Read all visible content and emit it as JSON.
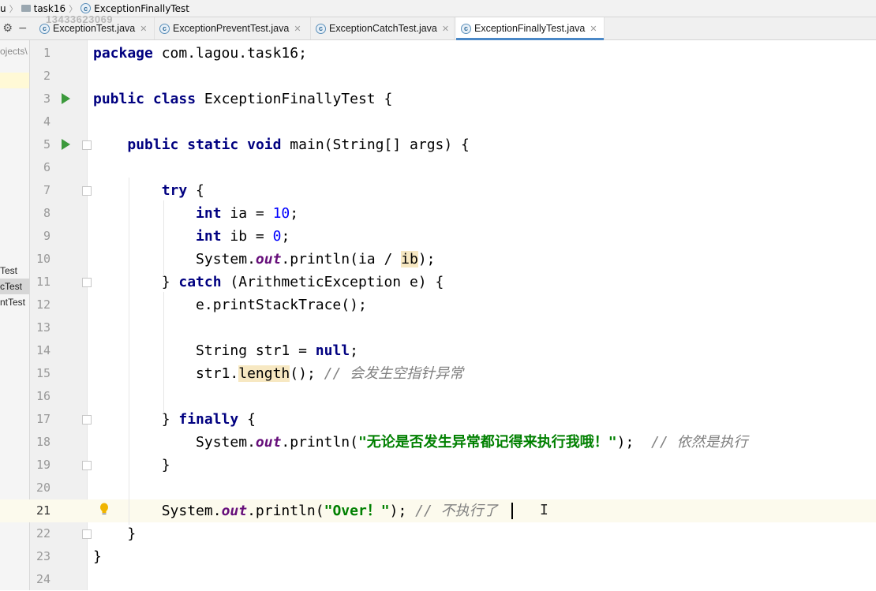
{
  "breadcrumb": {
    "root": "u",
    "folder": "task16",
    "file": "ExceptionFinallyTest"
  },
  "watermark": "13433623069",
  "tab_tools": {
    "settings": "⚙",
    "minimize": "−"
  },
  "tabs": [
    {
      "label": "ExceptionTest.java",
      "active": false
    },
    {
      "label": "ExceptionPreventTest.java",
      "active": false
    },
    {
      "label": "ExceptionCatchTest.java",
      "active": false
    },
    {
      "label": "ExceptionFinallyTest.java",
      "active": true
    }
  ],
  "project_panel": {
    "items": [
      "ojects\\",
      "Test",
      "cTest",
      "ntTest"
    ]
  },
  "editor": {
    "current_line": 21,
    "lines": [
      {
        "n": "1",
        "tokens": [
          [
            "kw",
            "package"
          ],
          [
            "p",
            " com.lagou.task16;"
          ]
        ]
      },
      {
        "n": "2",
        "tokens": []
      },
      {
        "n": "3",
        "tokens": [
          [
            "kw",
            "public"
          ],
          [
            "p",
            " "
          ],
          [
            "kw",
            "class"
          ],
          [
            "p",
            " ExceptionFinallyTest {"
          ]
        ]
      },
      {
        "n": "4",
        "tokens": []
      },
      {
        "n": "5",
        "tokens": [
          [
            "p",
            "    "
          ],
          [
            "kw",
            "public"
          ],
          [
            "p",
            " "
          ],
          [
            "kw",
            "static"
          ],
          [
            "p",
            " "
          ],
          [
            "kw",
            "void"
          ],
          [
            "p",
            " main(String[] args) {"
          ]
        ]
      },
      {
        "n": "6",
        "tokens": []
      },
      {
        "n": "7",
        "tokens": [
          [
            "p",
            "        "
          ],
          [
            "kw",
            "try"
          ],
          [
            "p",
            " {"
          ]
        ]
      },
      {
        "n": "8",
        "tokens": [
          [
            "p",
            "            "
          ],
          [
            "kw",
            "int"
          ],
          [
            "p",
            " ia = "
          ],
          [
            "num",
            "10"
          ],
          [
            "p",
            ";"
          ]
        ]
      },
      {
        "n": "9",
        "tokens": [
          [
            "p",
            "            "
          ],
          [
            "kw",
            "int"
          ],
          [
            "p",
            " ib = "
          ],
          [
            "num",
            "0"
          ],
          [
            "p",
            ";"
          ]
        ]
      },
      {
        "n": "10",
        "tokens": [
          [
            "p",
            "            System."
          ],
          [
            "field",
            "out"
          ],
          [
            "p",
            ".println(ia / "
          ],
          [
            "hl",
            "ib"
          ],
          [
            "p",
            ");"
          ]
        ]
      },
      {
        "n": "11",
        "tokens": [
          [
            "p",
            "        } "
          ],
          [
            "kw",
            "catch"
          ],
          [
            "p",
            " (ArithmeticException e) {"
          ]
        ]
      },
      {
        "n": "12",
        "tokens": [
          [
            "p",
            "            e.printStackTrace();"
          ]
        ]
      },
      {
        "n": "13",
        "tokens": []
      },
      {
        "n": "14",
        "tokens": [
          [
            "p",
            "            String str1 = "
          ],
          [
            "kw",
            "null"
          ],
          [
            "p",
            ";"
          ]
        ]
      },
      {
        "n": "15",
        "tokens": [
          [
            "p",
            "            str1."
          ],
          [
            "hl",
            "length"
          ],
          [
            "p",
            "(); "
          ],
          [
            "cmt",
            "// 会发生空指针异常"
          ]
        ]
      },
      {
        "n": "16",
        "tokens": []
      },
      {
        "n": "17",
        "tokens": [
          [
            "p",
            "        } "
          ],
          [
            "kw",
            "finally"
          ],
          [
            "p",
            " {"
          ]
        ]
      },
      {
        "n": "18",
        "tokens": [
          [
            "p",
            "            System."
          ],
          [
            "field",
            "out"
          ],
          [
            "p",
            ".println("
          ],
          [
            "str",
            "\"无论是否发生异常都记得来执行我哦！\""
          ],
          [
            "p",
            ");  "
          ],
          [
            "cmt",
            "// 依然是执行"
          ]
        ]
      },
      {
        "n": "19",
        "tokens": [
          [
            "p",
            "        }"
          ]
        ]
      },
      {
        "n": "20",
        "tokens": []
      },
      {
        "n": "21",
        "tokens": [
          [
            "p",
            "        System."
          ],
          [
            "field",
            "out"
          ],
          [
            "p",
            ".println("
          ],
          [
            "str",
            "\"Over！\""
          ],
          [
            "p",
            "); "
          ],
          [
            "cmt",
            "// 不执行了"
          ]
        ]
      },
      {
        "n": "22",
        "tokens": [
          [
            "p",
            "    }"
          ]
        ]
      },
      {
        "n": "23",
        "tokens": [
          [
            "p",
            "}"
          ]
        ]
      },
      {
        "n": "24",
        "tokens": []
      }
    ]
  },
  "gutter_icons": {
    "run_lines": [
      3,
      5
    ],
    "fold_lines": [
      5,
      7,
      11,
      17,
      19,
      22
    ],
    "bulb_line": 21,
    "run_color": "#3c9a3c",
    "bulb_color": "#f0b400"
  }
}
